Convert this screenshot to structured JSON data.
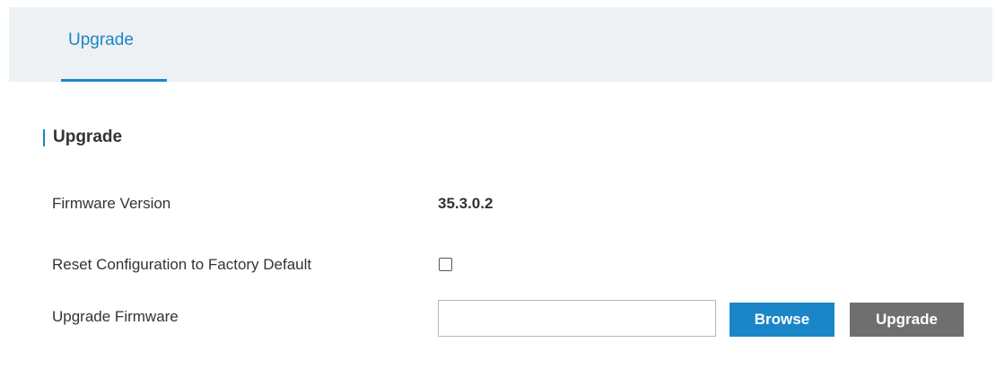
{
  "tabs": [
    {
      "label": "Upgrade",
      "active": true
    }
  ],
  "section": {
    "title": "Upgrade"
  },
  "fields": {
    "firmware_version": {
      "label": "Firmware Version",
      "value": "35.3.0.2"
    },
    "reset_factory_default": {
      "label": "Reset Configuration to Factory Default",
      "checked": false
    },
    "upgrade_firmware": {
      "label": "Upgrade Firmware",
      "value": "",
      "placeholder": ""
    }
  },
  "buttons": {
    "browse_label": "Browse",
    "upgrade_label": "Upgrade"
  },
  "colors": {
    "accent": "#1a86c8",
    "tabbar_bg": "#eef1f3",
    "upgrade_button": "#6f6f6f"
  }
}
